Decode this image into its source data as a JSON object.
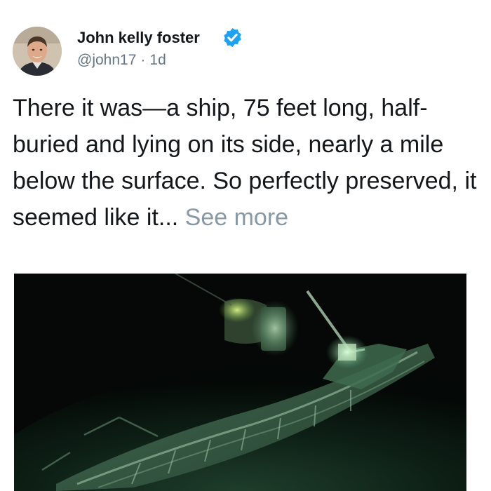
{
  "tweet": {
    "author": {
      "name": "John kelly foster",
      "handle": "@john17",
      "verified": true
    },
    "separator": "·",
    "time": "1d",
    "text": "There it was—a ship, 75 feet long, half-buried and lying on its side, nearly a mile below the surface. So perfectly preserved, it seemed like it...",
    "see_more_label": "See more",
    "icons": {
      "verified": "verified-badge-icon",
      "avatar": "avatar"
    },
    "colors": {
      "text": "#14171a",
      "secondary": "#657786",
      "see_more": "#8899a6",
      "verified": "#1da1f2"
    }
  }
}
